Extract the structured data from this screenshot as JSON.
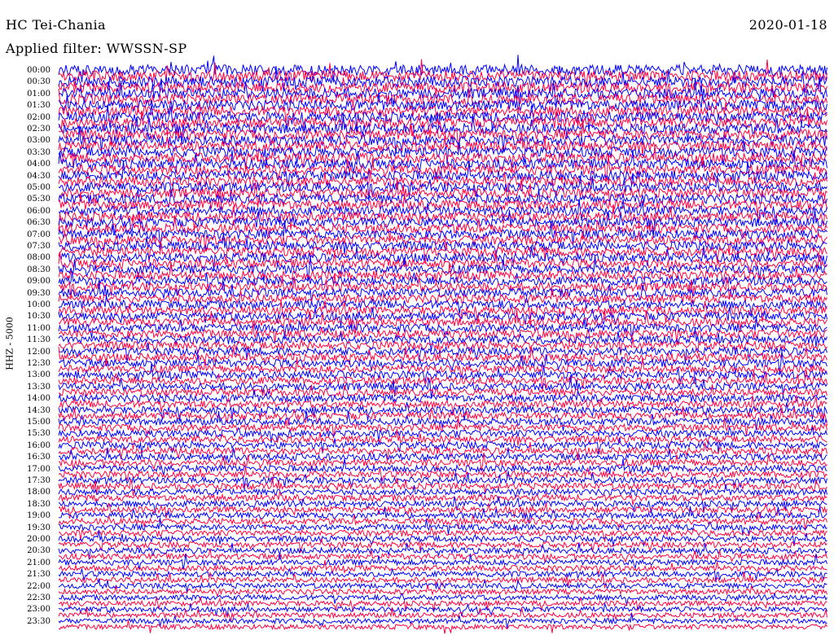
{
  "header": {
    "station": "HC Tei-Chania",
    "date": "2020-01-18",
    "filter": "Applied filter: WWSSN-SP"
  },
  "channel_label": "HHZ - 5000",
  "colors": {
    "trace_a": "#0000ff",
    "trace_b": "#ff0040",
    "background": "#ffffff",
    "text": "#000000"
  },
  "chart_data": {
    "type": "line",
    "title": "HC Tei-Chania",
    "ylabel": "HHZ - 5000",
    "row_interval_minutes": 15,
    "time_labels": [
      "00:00",
      "00:30",
      "01:00",
      "01:30",
      "02:00",
      "02:30",
      "03:00",
      "03:30",
      "04:00",
      "04:30",
      "05:00",
      "05:30",
      "06:00",
      "06:30",
      "07:00",
      "07:30",
      "08:00",
      "08:30",
      "09:00",
      "09:30",
      "10:00",
      "10:30",
      "11:00",
      "11:30",
      "12:00",
      "12:30",
      "13:00",
      "13:30",
      "14:00",
      "14:30",
      "15:00",
      "15:30",
      "16:00",
      "16:30",
      "17:00",
      "17:30",
      "18:00",
      "18:30",
      "19:00",
      "19:30",
      "20:00",
      "20:30",
      "21:00",
      "21:30",
      "22:00",
      "22:30",
      "23:00",
      "23:30"
    ],
    "trace_count": 96,
    "series": [
      {
        "color": "#0000ff",
        "rows": "on the hour and half hour"
      },
      {
        "color": "#ff0040",
        "rows": "quarter past and quarter to"
      }
    ]
  }
}
